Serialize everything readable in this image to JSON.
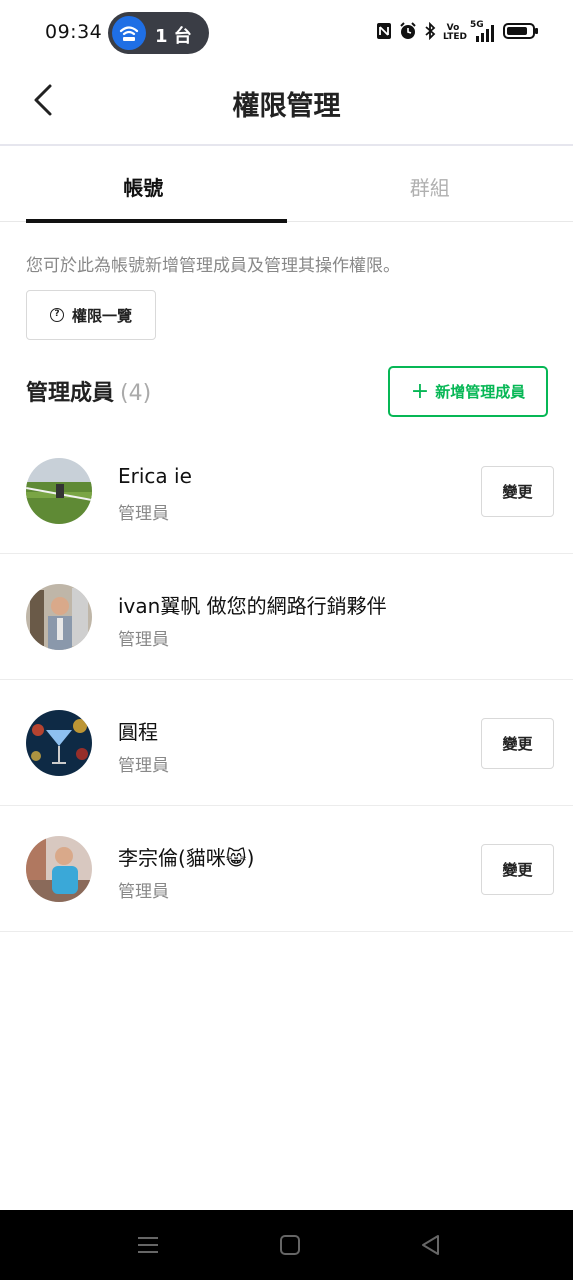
{
  "status_bar": {
    "time": "09:34",
    "hotspot_count": "1 台",
    "network_label_top": "5G",
    "volte_label": "Vo LTED",
    "colors": {
      "hotspot_bg": "#3a3d45",
      "hotspot_icon": "#1f6fe5"
    }
  },
  "header": {
    "title": "權限管理",
    "back_icon": "chevron-left-icon"
  },
  "tabs": [
    {
      "label": "帳號",
      "active": true
    },
    {
      "label": "群組",
      "active": false
    }
  ],
  "description": "您可於此為帳號新增管理成員及管理其操作權限。",
  "permission_button": {
    "label": "權限一覽",
    "icon": "question-circle-icon"
  },
  "members_section": {
    "title": "管理成員",
    "count": "(4)",
    "add_button": {
      "label": "新增管理成員",
      "icon": "plus-icon"
    }
  },
  "members": [
    {
      "name": "Erica ie",
      "role": "管理員",
      "change_label": "變更",
      "has_change": true
    },
    {
      "name": "ivan翼帆 做您的網路行銷夥伴",
      "role": "管理員",
      "change_label": "",
      "has_change": false
    },
    {
      "name": "圓程",
      "role": "管理員",
      "change_label": "變更",
      "has_change": true
    },
    {
      "name": "李宗倫(貓咪😸)",
      "role": "管理員",
      "change_label": "變更",
      "has_change": true
    }
  ],
  "nav_bar": [
    "menu-icon",
    "home-square-icon",
    "back-triangle-icon"
  ],
  "colors": {
    "accent": "#06b755",
    "text": "#111111",
    "muted": "#888888"
  }
}
